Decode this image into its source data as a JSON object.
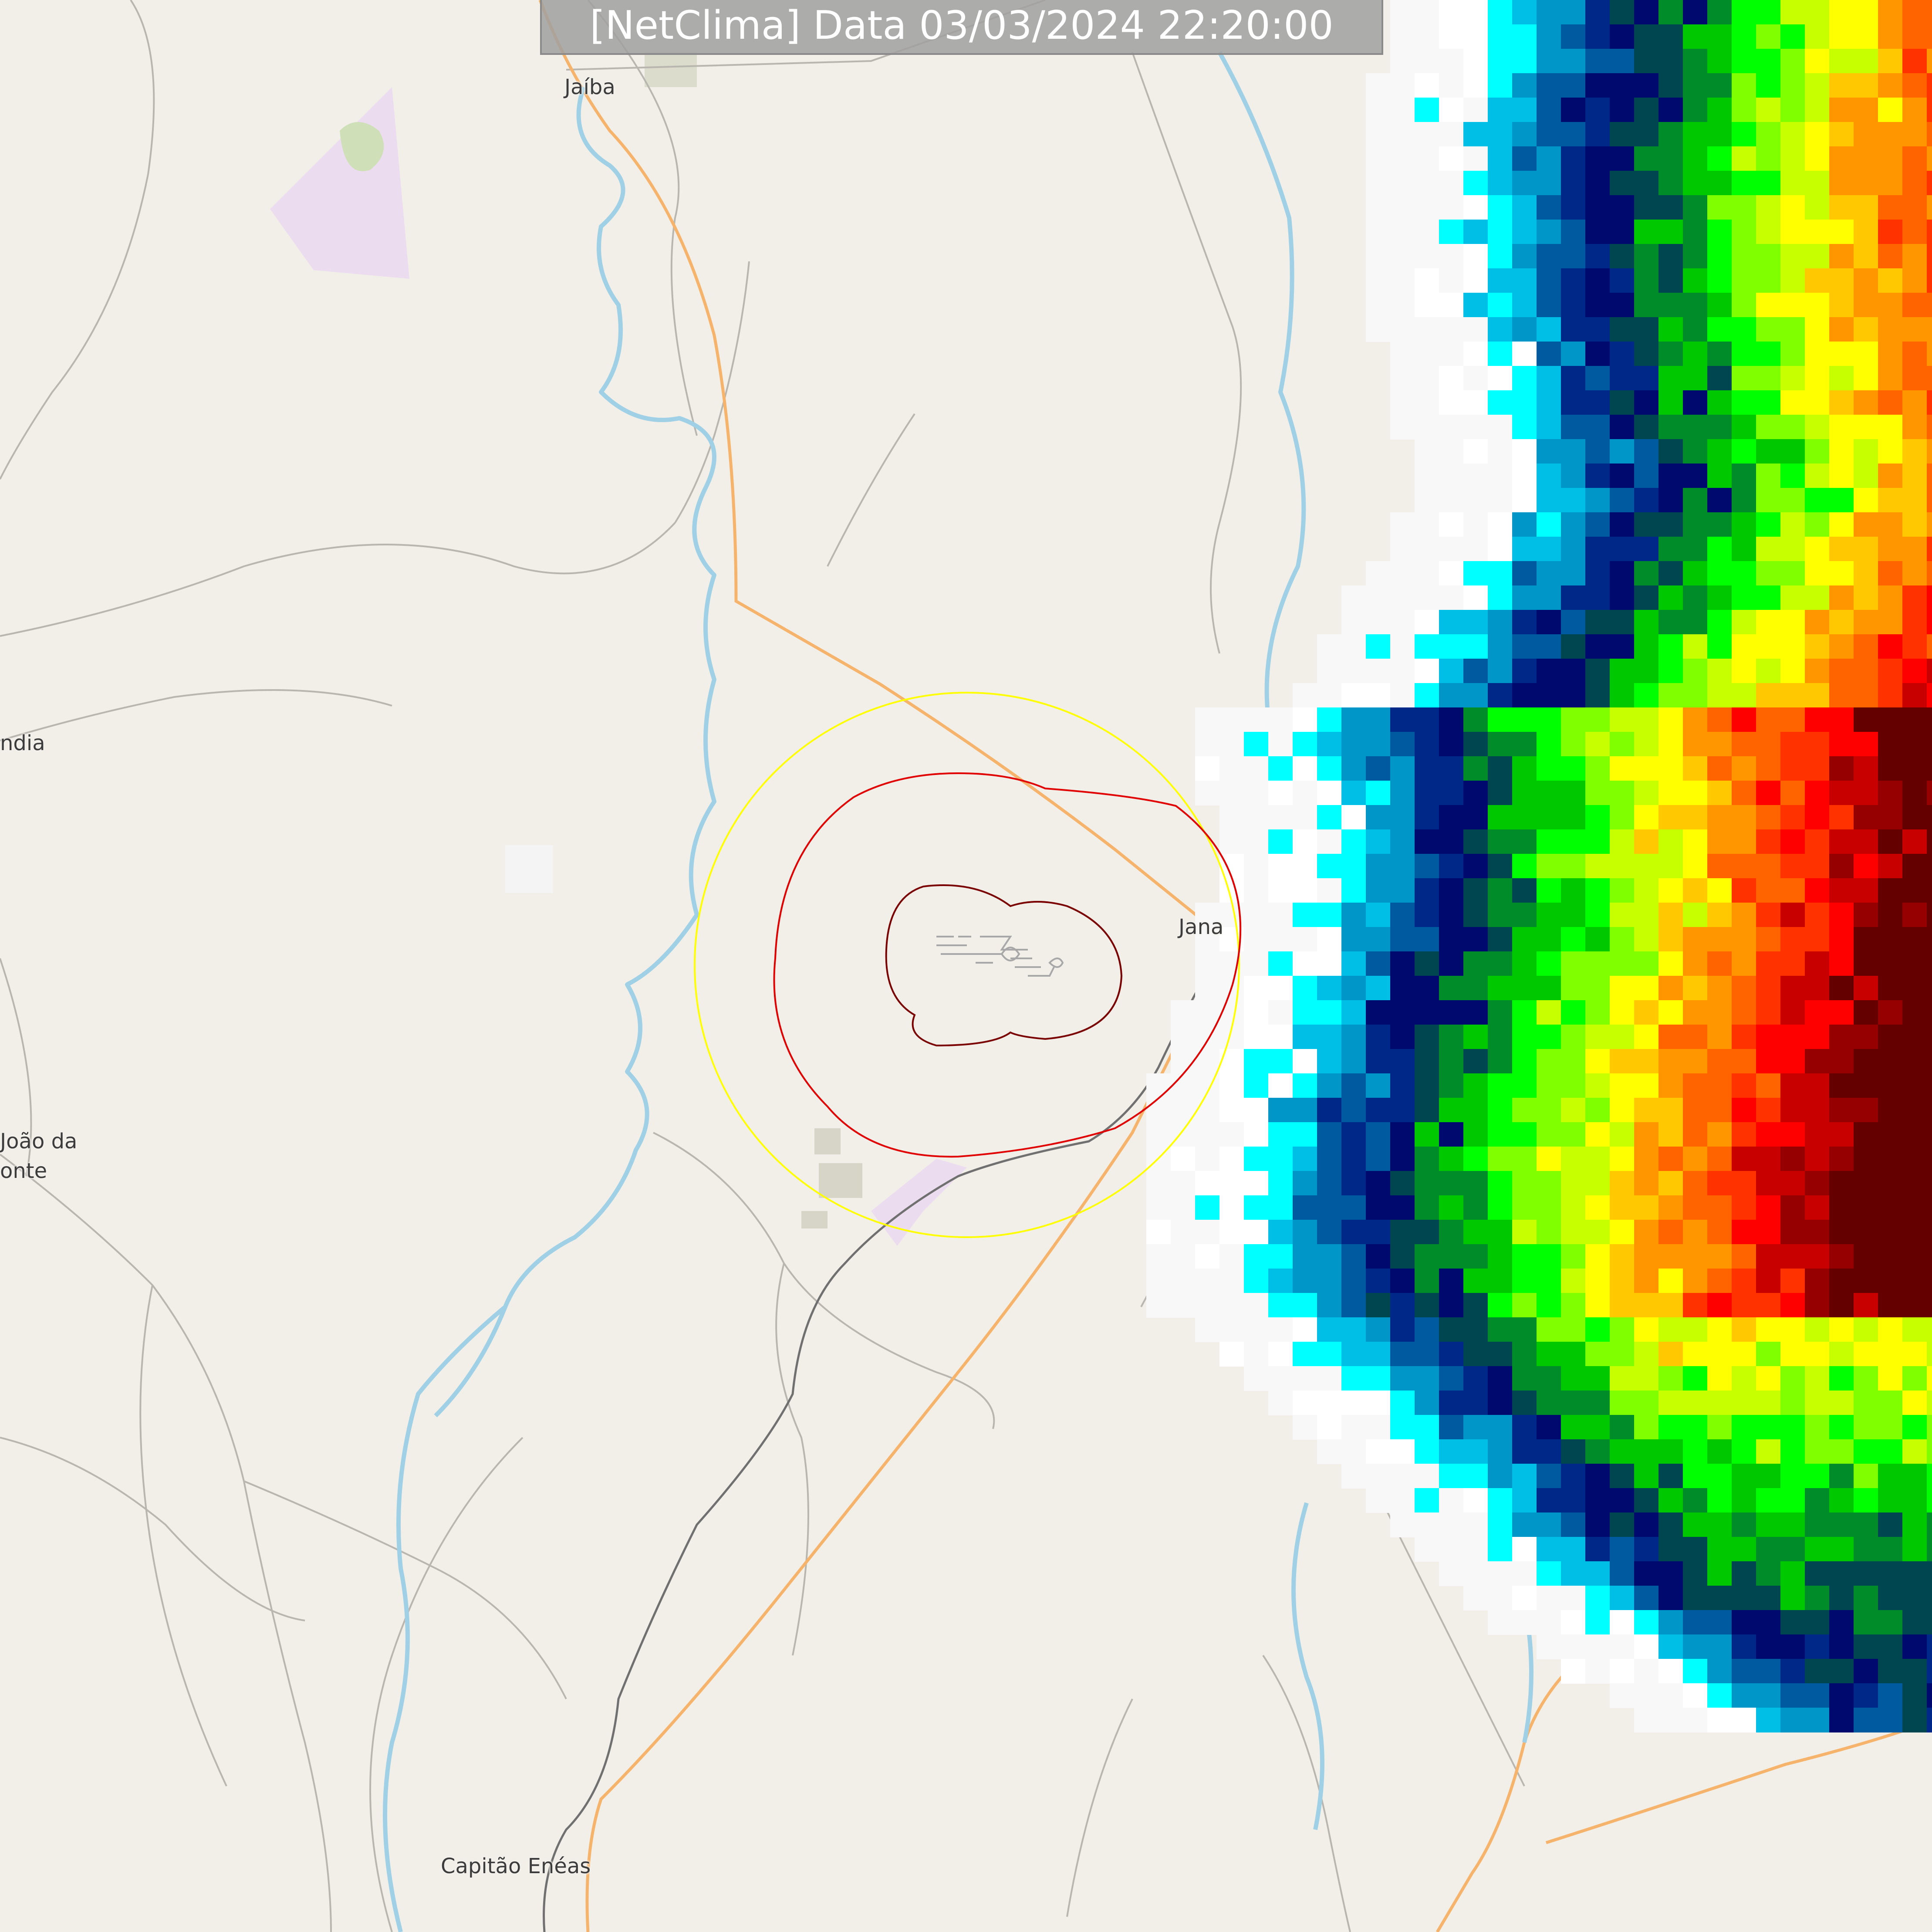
{
  "overlay": {
    "timestamp": "[NetClima] Data 03/03/2024 22:20:00"
  },
  "places": {
    "jaiba": "Jaíba",
    "janauba": "Jana",
    "india": "ndia",
    "joao_line1": "João da",
    "joao_line2": "onte",
    "capitao": "Capitão Enéas"
  },
  "radar": {
    "palette": [
      "#f8f8f8",
      "#ffffff",
      "#00ffff",
      "#00bfe6",
      "#0096c8",
      "#005aa0",
      "#002888",
      "#000a6e",
      "#004650",
      "#008c28",
      "#00c800",
      "#00ff00",
      "#80ff00",
      "#c8ff00",
      "#ffff00",
      "#ffc800",
      "#ff9600",
      "#ff6400",
      "#ff3200",
      "#ff0000",
      "#c80000",
      "#960000",
      "#640000"
    ],
    "rings": [
      "#ffff00",
      "#e00000",
      "#7a0000"
    ]
  }
}
